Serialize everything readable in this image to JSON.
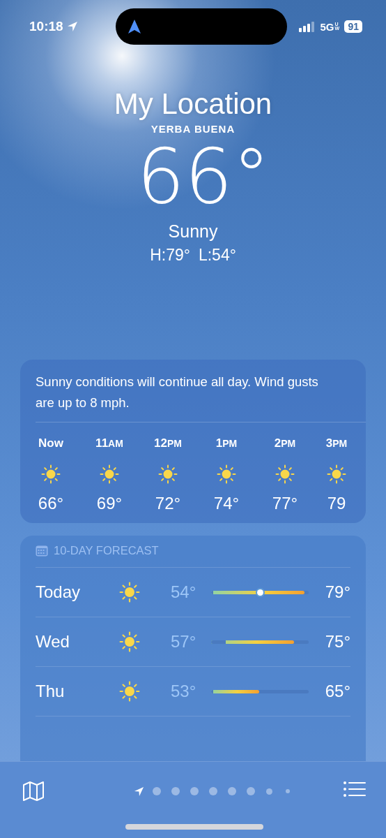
{
  "status_bar": {
    "time": "10:18",
    "network": "5G",
    "network_sub": "UW",
    "battery": "91"
  },
  "header": {
    "title": "My Location",
    "place": "YERBA BUENA",
    "temperature": "66°",
    "condition": "Sunny",
    "high": "H:79°",
    "low": "L:54°"
  },
  "hourly": {
    "summary": "Sunny conditions will continue all day. Wind gusts are up to 8 mph.",
    "hours": [
      {
        "hour": "Now",
        "temp": "66°"
      },
      {
        "hour": "11",
        "suffix": "AM",
        "temp": "69°"
      },
      {
        "hour": "12",
        "suffix": "PM",
        "temp": "72°"
      },
      {
        "hour": "1",
        "suffix": "PM",
        "temp": "74°"
      },
      {
        "hour": "2",
        "suffix": "PM",
        "temp": "77°"
      },
      {
        "hour": "3",
        "suffix": "PM",
        "temp": "79"
      }
    ]
  },
  "forecast": {
    "title": "10-DAY FORECAST",
    "days": [
      {
        "day": "Today",
        "low": "54°",
        "high": "79°",
        "bar_start": {
          "level": 0.02
        },
        "bar_end": {
          "level": 0.96
        },
        "now_marker": {
          "level": 0.5
        }
      },
      {
        "day": "Wed",
        "low": "57°",
        "high": "75°",
        "bar_start": {
          "level": 0.15
        },
        "bar_end": {
          "level": 0.85
        }
      },
      {
        "day": "Thu",
        "low": "53°",
        "high": "65°",
        "bar_start": {
          "level": 0.02
        },
        "bar_end": {
          "level": 0.49
        }
      }
    ]
  },
  "pages": [
    {
      "kind": "location",
      "selected": true
    },
    {
      "kind": "dot",
      "selected": false
    },
    {
      "kind": "dot",
      "selected": false
    },
    {
      "kind": "dot",
      "selected": false
    },
    {
      "kind": "dot",
      "selected": false
    },
    {
      "kind": "dot",
      "selected": false
    },
    {
      "kind": "dot",
      "selected": false
    },
    {
      "kind": "small",
      "selected": false
    },
    {
      "kind": "tiny",
      "selected": false
    }
  ]
}
